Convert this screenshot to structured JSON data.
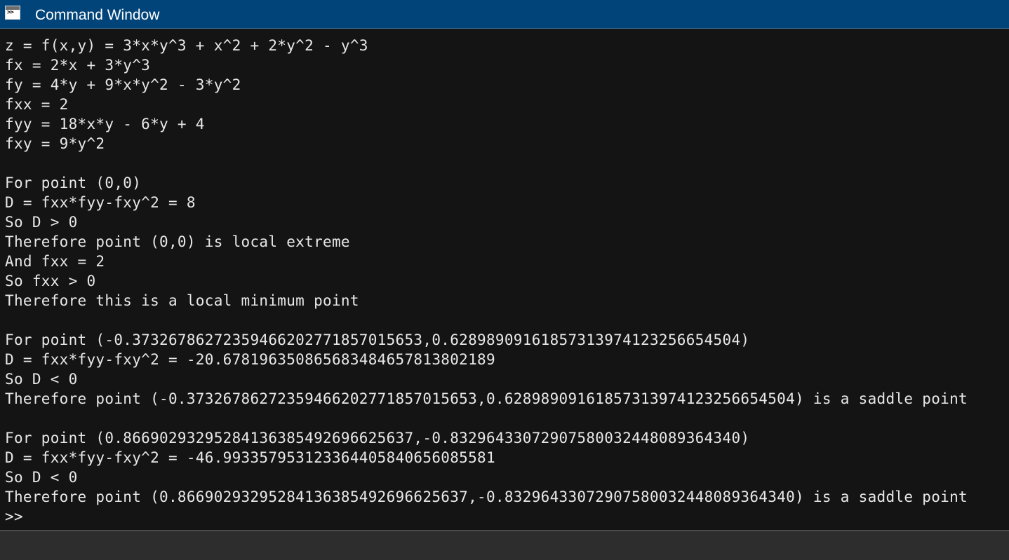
{
  "window": {
    "title": "Command Window",
    "title_icon_glyph": ">>",
    "icon": "command-window-icon"
  },
  "colors": {
    "titlebar": "#00447a",
    "console_bg": "#141414",
    "console_text": "#e8e8e8",
    "statusbar": "#2d2d2d"
  },
  "console": {
    "lines": [
      "z = f(x,y) = 3*x*y^3 + x^2 + 2*y^2 - y^3",
      "fx = 2*x + 3*y^3",
      "fy = 4*y + 9*x*y^2 - 3*y^2",
      "fxx = 2",
      "fyy = 18*x*y - 6*y + 4",
      "fxy = 9*y^2",
      "",
      "For point (0,0)",
      "D = fxx*fyy-fxy^2 = 8",
      "So D > 0",
      "Therefore point (0,0) is local extreme",
      "And fxx = 2",
      "So fxx > 0",
      "Therefore this is a local minimum point",
      "",
      "For point (-0.37326786272359466202771857015653,0.62898909161857313974123256654504)",
      "D = fxx*fyy-fxy^2 = -20.678196350865683484657813802189",
      "So D < 0",
      "Therefore point (-0.37326786272359466202771857015653,0.62898909161857313974123256654504) is a saddle point",
      "",
      "For point (0.86690293295284136385492696625637,-0.83296433072907580032448089364340)",
      "D = fxx*fyy-fxy^2 = -46.993357953123364405840656085581",
      "So D < 0",
      "Therefore point (0.86690293295284136385492696625637,-0.83296433072907580032448089364340) is a saddle point"
    ],
    "prompt": ">>"
  }
}
